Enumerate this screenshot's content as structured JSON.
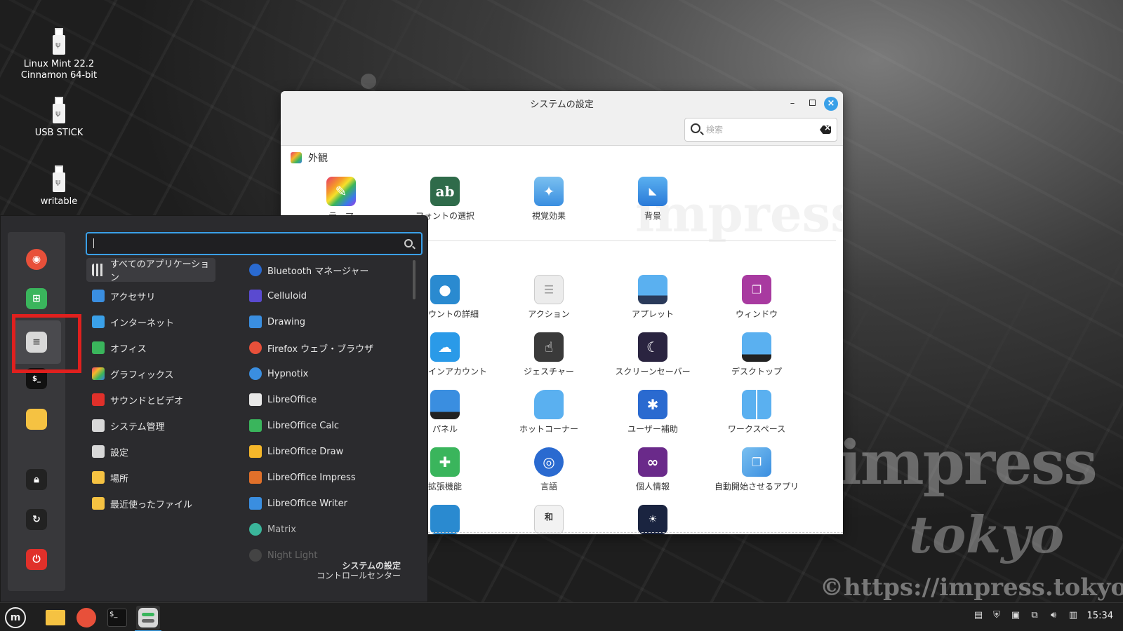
{
  "desktop": {
    "icons": [
      {
        "label_line1": "Linux Mint 22.2",
        "label_line2": "Cinnamon 64-bit"
      },
      {
        "label_line1": "USB STICK",
        "label_line2": ""
      },
      {
        "label_line1": "writable",
        "label_line2": ""
      }
    ],
    "watermark": {
      "word1": "impress",
      "word2": "tokyo",
      "url": "©https://impress.tokyo",
      "window_word": "impress"
    }
  },
  "settings_window": {
    "title": "システムの設定",
    "search_placeholder": "検索",
    "controls": {
      "minimize": "–",
      "close": "×"
    },
    "sections": [
      {
        "title": "外観",
        "items": [
          "テーマ",
          "フォントの選択",
          "視覚効果",
          "背景"
        ]
      },
      {
        "title": "",
        "items": [
          "アカウントの詳細",
          "アクション",
          "アプレット",
          "ウィンドウ",
          "オンラインアカウント",
          "ジェスチャー",
          "スクリーンセーバー",
          "デスクトップ",
          "パネル",
          "ホットコーナー",
          "ユーザー補助",
          "ワークスペース",
          "拡張機能",
          "言語",
          "個人情報",
          "自動開始させるアプリ"
        ]
      }
    ],
    "colors": {
      "accent": "#3aa0e8"
    }
  },
  "start_menu": {
    "search_value": "",
    "categories": [
      {
        "label": "すべてのアプリケーション",
        "selected": true
      },
      {
        "label": "アクセサリ"
      },
      {
        "label": "インターネット"
      },
      {
        "label": "オフィス"
      },
      {
        "label": "グラフィックス"
      },
      {
        "label": "サウンドとビデオ"
      },
      {
        "label": "システム管理"
      },
      {
        "label": "設定"
      },
      {
        "label": "場所"
      },
      {
        "label": "最近使ったファイル"
      }
    ],
    "apps": [
      {
        "label": "Bluetooth マネージャー"
      },
      {
        "label": "Celluloid"
      },
      {
        "label": "Drawing"
      },
      {
        "label": "Firefox ウェブ・ブラウザ"
      },
      {
        "label": "Hypnotix"
      },
      {
        "label": "LibreOffice"
      },
      {
        "label": "LibreOffice Calc"
      },
      {
        "label": "LibreOffice Draw"
      },
      {
        "label": "LibreOffice Impress"
      },
      {
        "label": "LibreOffice Writer"
      },
      {
        "label": "Matrix"
      },
      {
        "label": "Night Light"
      }
    ],
    "description": {
      "title": "システムの設定",
      "subtitle": "コントロールセンター"
    },
    "favorites": [
      "firefox-icon",
      "software-manager-icon",
      "system-settings-icon",
      "terminal-icon",
      "folder-icon",
      "lock-icon",
      "logout-icon",
      "power-icon"
    ]
  },
  "taskbar": {
    "clock": "15:34",
    "items": [
      "mint-menu-icon",
      "folder-icon",
      "firefox-icon",
      "terminal-icon",
      "system-settings-icon"
    ]
  }
}
